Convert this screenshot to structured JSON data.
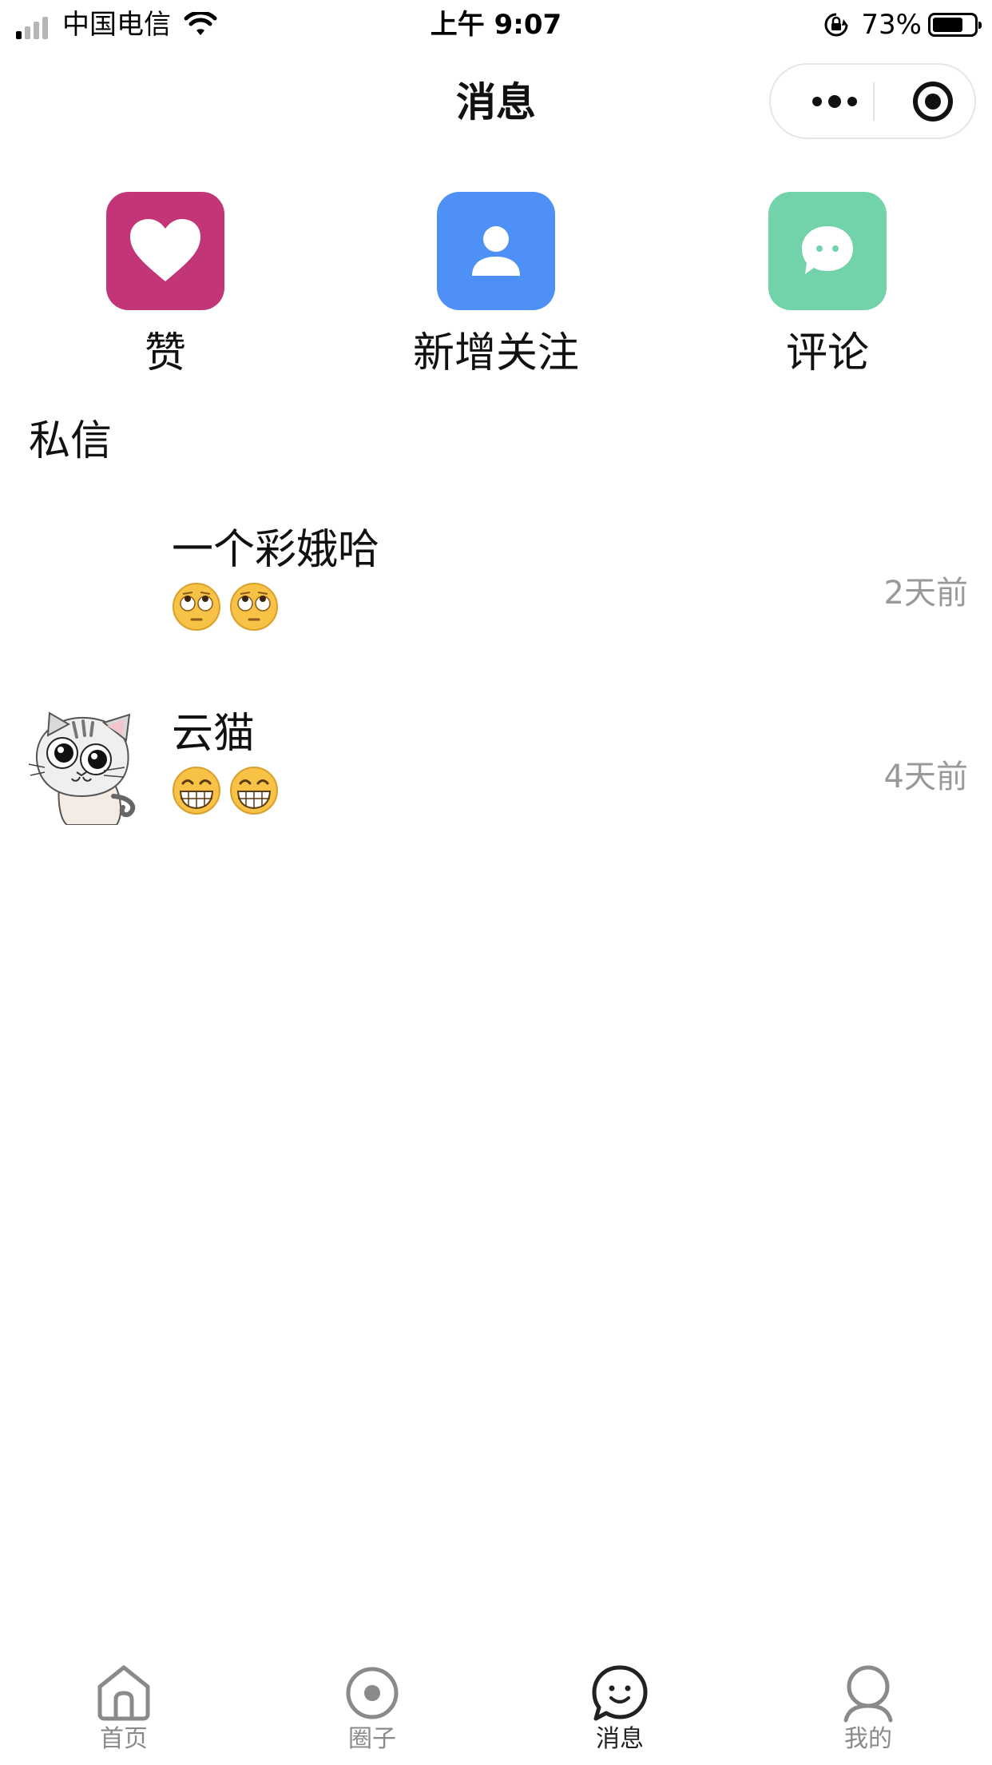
{
  "status_bar": {
    "carrier": "中国电信",
    "time": "上午 9:07",
    "battery": "73%",
    "battery_level": 0.73,
    "signal_bars_active": 1
  },
  "nav": {
    "title": "消息",
    "more_icon": "more-dots-icon",
    "close_icon": "target-circle-icon"
  },
  "quick_actions": [
    {
      "label": "赞",
      "icon": "heart-icon",
      "color": "#C23576"
    },
    {
      "label": "新增关注",
      "icon": "person-icon",
      "color": "#4E90F5"
    },
    {
      "label": "评论",
      "icon": "chat-bubble-icon",
      "color": "#72D3AA"
    }
  ],
  "section": {
    "title": "私信"
  },
  "messages": [
    {
      "name": "一个彩娥哈",
      "avatar": "blank",
      "preview_emoji": [
        "rolling-eyes-emoji",
        "rolling-eyes-emoji"
      ],
      "time": "2天前"
    },
    {
      "name": "云猫",
      "avatar": "cartoon-cat",
      "preview_emoji": [
        "grinning-emoji",
        "grinning-emoji"
      ],
      "time": "4天前"
    }
  ],
  "tabbar": {
    "items": [
      {
        "label": "首页",
        "icon": "home-icon",
        "active": false
      },
      {
        "label": "圈子",
        "icon": "circle-dot-icon",
        "active": false
      },
      {
        "label": "消息",
        "icon": "message-smile-icon",
        "active": true
      },
      {
        "label": "我的",
        "icon": "user-icon",
        "active": false
      }
    ]
  }
}
